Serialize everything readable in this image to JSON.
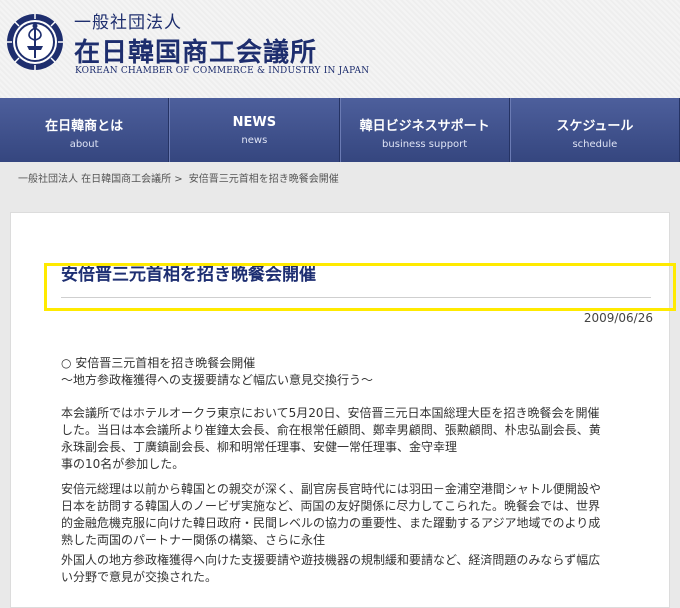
{
  "header": {
    "org_prefix": "一般社団法人",
    "org_name": "在日韓国商工会議所",
    "org_name_en": "KOREAN CHAMBER OF COMMERCE & INDUSTRY IN JAPAN",
    "logo_icon": "emblem-icon"
  },
  "nav": [
    {
      "label": "在日韓商とは",
      "sub": "about"
    },
    {
      "label": "NEWS",
      "sub": "news"
    },
    {
      "label": "韓日ビジネスサポート",
      "sub": "business support"
    },
    {
      "label": "スケジュール",
      "sub": "schedule"
    }
  ],
  "breadcrumb": {
    "home": "一般社団法人 在日韓国商工会議所",
    "separator": ">",
    "current": "安倍晋三元首相を招き晩餐会開催"
  },
  "article": {
    "title": "安倍晋三元首相を招き晩餐会開催",
    "date": "2009/06/26",
    "heading_line1": "○ 安倍晋三元首相を招き晩餐会開催",
    "heading_line2": "～地方参政権獲得への支援要請など幅広い意見交換行う～",
    "para1": [
      "本会議所ではホテルオークラ東京において5月20日、安倍晋三元日本国総理大臣を招き晩餐会を開催",
      "した。当日は本会議所より崔鐘太会長、俞在根常任顧問、鄭幸男顧問、張勲顧問、朴忠弘副会長、黄",
      "永珠副会長、丁廣鎮副会長、柳和明常任理事、安健一常任理事、金守幸理",
      "事の10名が参加した。"
    ],
    "para2": [
      "安倍元総理は以前から韓国との親交が深く、副官房長官時代には羽田－金浦空港間シャトル便開設や",
      "日本を訪問する韓国人のノービザ実施など、両国の友好関係に尽力してこられた。晩餐会では、世界",
      "的金融危機克服に向けた韓日政府・民間レベルの協力の重要性、また躍動するアジア地域でのより成",
      "熟した両国のパートナー関係の構築、さらに永住",
      "外国人の地方参政権獲得へ向けた支援要請や遊技機器の規制緩和要請など、経済問題のみならず幅広",
      "い分野で意見が交換された。"
    ]
  },
  "colors": {
    "nav": "#3e4f8c",
    "title": "#1e2f72",
    "highlight": "#ffea00"
  }
}
